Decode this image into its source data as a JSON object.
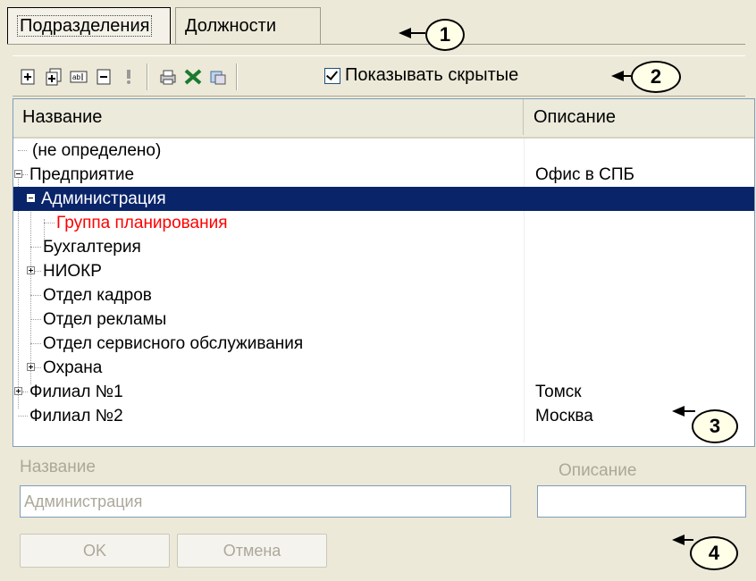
{
  "tabs": [
    {
      "label": "Подразделения",
      "active": true
    },
    {
      "label": "Должности",
      "active": false
    }
  ],
  "toolbar": {
    "icons": [
      "add-icon",
      "add-child-icon",
      "rename-icon",
      "delete-icon",
      "info-icon",
      "print-icon",
      "excel-icon",
      "export-icon"
    ],
    "show_hidden_label": "Показывать скрытые",
    "show_hidden_checked": true
  },
  "grid": {
    "columns": [
      "Название",
      "Описание"
    ],
    "rows": [
      {
        "name": "(не определено)",
        "desc": ""
      },
      {
        "name": "Предприятие",
        "desc": "Офис в СПБ"
      },
      {
        "name": "Администрация",
        "desc": "",
        "selected": true
      },
      {
        "name": "Группа планирования",
        "desc": "",
        "hidden_color": "#ff0000"
      },
      {
        "name": "Бухгалтерия",
        "desc": ""
      },
      {
        "name": "НИОКР",
        "desc": ""
      },
      {
        "name": "Отдел кадров",
        "desc": ""
      },
      {
        "name": "Отдел рекламы",
        "desc": ""
      },
      {
        "name": "Отдел сервисного обслуживания",
        "desc": ""
      },
      {
        "name": "Охрана",
        "desc": ""
      },
      {
        "name": "Филиал №1",
        "desc": "Томск"
      },
      {
        "name": "Филиал №2",
        "desc": "Москва"
      }
    ]
  },
  "form": {
    "name_label": "Название",
    "name_value": "Администрация",
    "desc_label": "Описание",
    "desc_value": "",
    "ok_label": "OK",
    "cancel_label": "Отмена"
  },
  "callouts": [
    "1",
    "2",
    "3",
    "4"
  ],
  "colors": {
    "selection": "#0a246a",
    "hidden_item": "#ff0000",
    "window_bg": "#ece9d8"
  }
}
